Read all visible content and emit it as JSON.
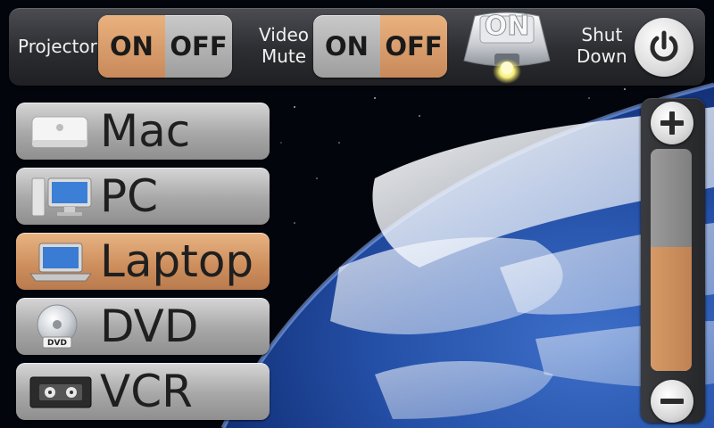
{
  "topbar": {
    "projector_label": "Projector",
    "projector_on": "ON",
    "projector_off": "OFF",
    "projector_state": "on",
    "video_mute_label_line1": "Video",
    "video_mute_label_line2": "Mute",
    "video_mute_on": "ON",
    "video_mute_off": "OFF",
    "video_mute_state": "off",
    "projector_icon_label": "ON",
    "shutdown_label_line1": "Shut",
    "shutdown_label_line2": "Down"
  },
  "sources": [
    {
      "label": "Mac",
      "icon": "mac-mini-icon",
      "active": false
    },
    {
      "label": "PC",
      "icon": "desktop-pc-icon",
      "active": false
    },
    {
      "label": "Laptop",
      "icon": "laptop-icon",
      "active": true
    },
    {
      "label": "DVD",
      "icon": "dvd-disc-icon",
      "active": false
    },
    {
      "label": "VCR",
      "icon": "vcr-cassette-icon",
      "active": false
    }
  ],
  "volume": {
    "level": 0.56,
    "plus_icon": "plus-icon",
    "minus_icon": "minus-icon"
  },
  "colors": {
    "accent": "#cf8f5d",
    "button": "#b5b5b5",
    "bar": "#2c2d31"
  }
}
